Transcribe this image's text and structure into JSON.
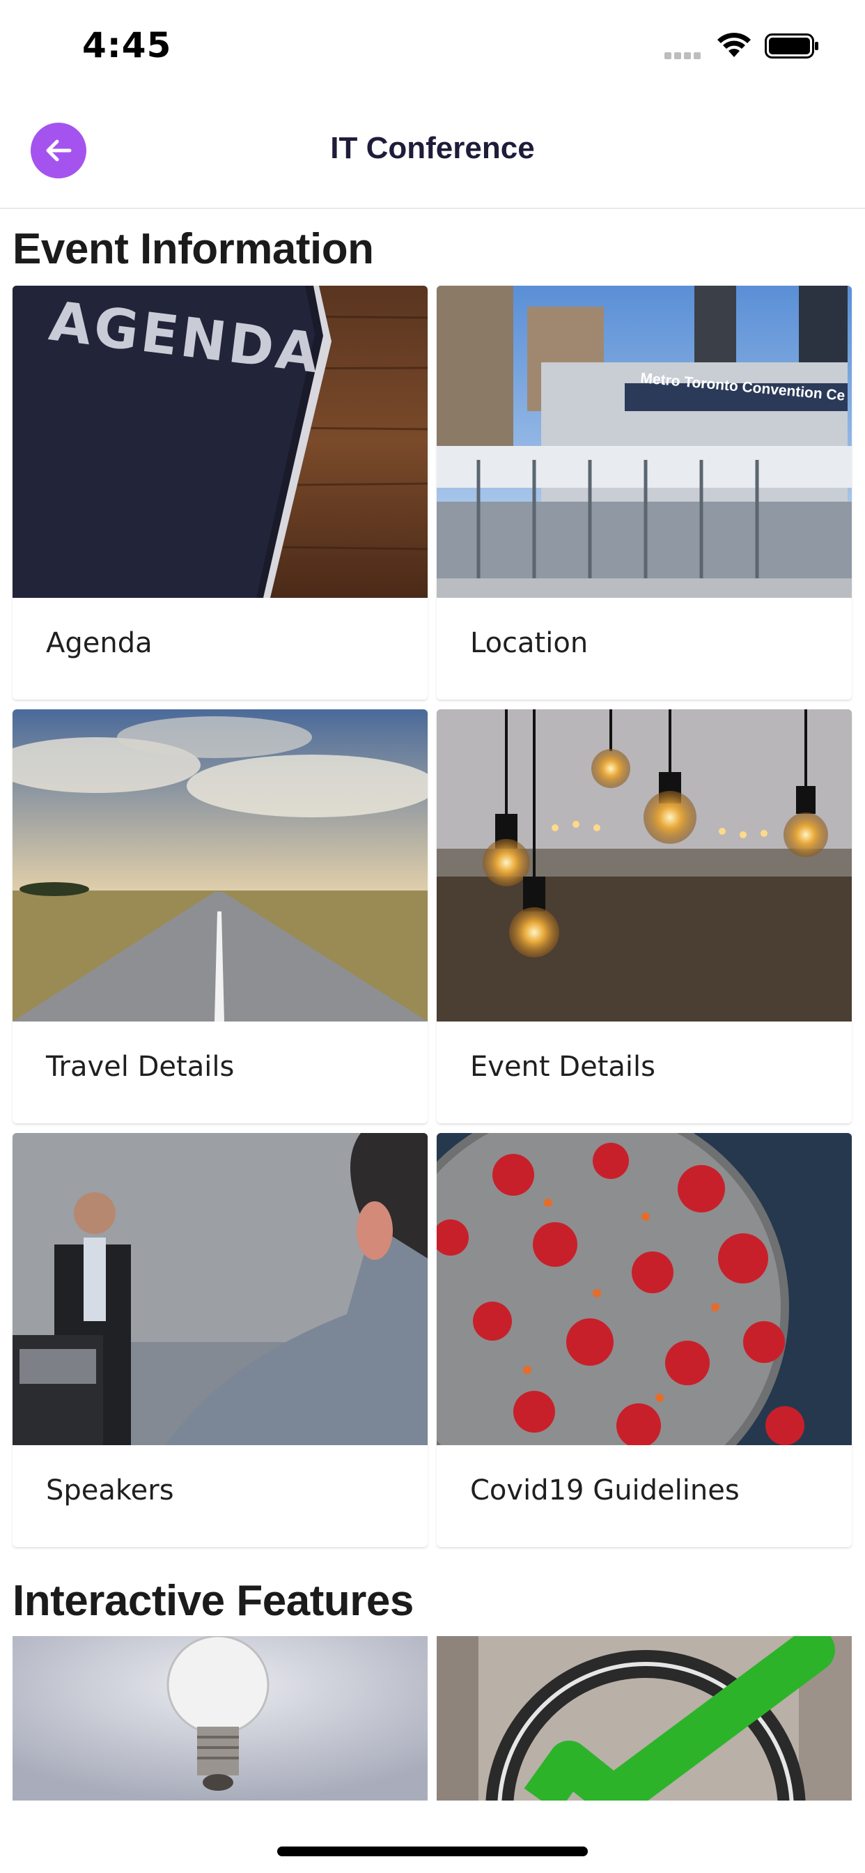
{
  "status_bar": {
    "time": "4:45"
  },
  "nav": {
    "title": "IT Conference",
    "back_icon": "arrow-left-icon",
    "accent": "#a553ee"
  },
  "sections": [
    {
      "title": "Event Information",
      "cards": [
        {
          "label": "Agenda",
          "image": "agenda-book-image"
        },
        {
          "label": "Location",
          "image": "convention-centre-image"
        },
        {
          "label": "Travel Details",
          "image": "road-image"
        },
        {
          "label": "Event Details",
          "image": "light-bulbs-image"
        },
        {
          "label": "Speakers",
          "image": "speaker-image"
        },
        {
          "label": "Covid19 Guidelines",
          "image": "virus-image"
        }
      ]
    },
    {
      "title": "Interactive Features",
      "cards": [
        {
          "label": "",
          "image": "lightbulb-image"
        },
        {
          "label": "",
          "image": "checkmark-image"
        }
      ]
    }
  ],
  "images": {
    "agenda_text": "AGENDA",
    "location_sign": "Metro Toronto Convention Ce"
  }
}
